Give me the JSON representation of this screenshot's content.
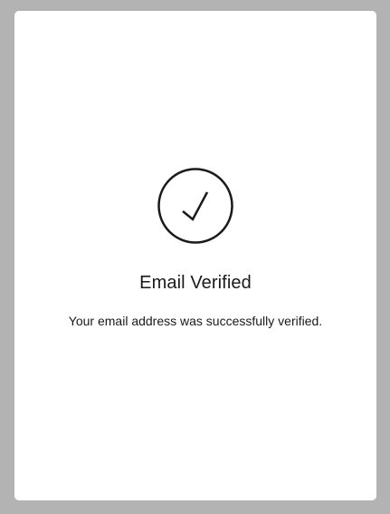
{
  "dialog": {
    "icon": "checkmark-circle-icon",
    "title": "Email Verified",
    "message": "Your email address was successfully verified."
  },
  "colors": {
    "backdrop": "#b3b3b3",
    "card": "#ffffff",
    "text": "#1a1a1a",
    "icon_stroke": "#1a1a1a"
  }
}
